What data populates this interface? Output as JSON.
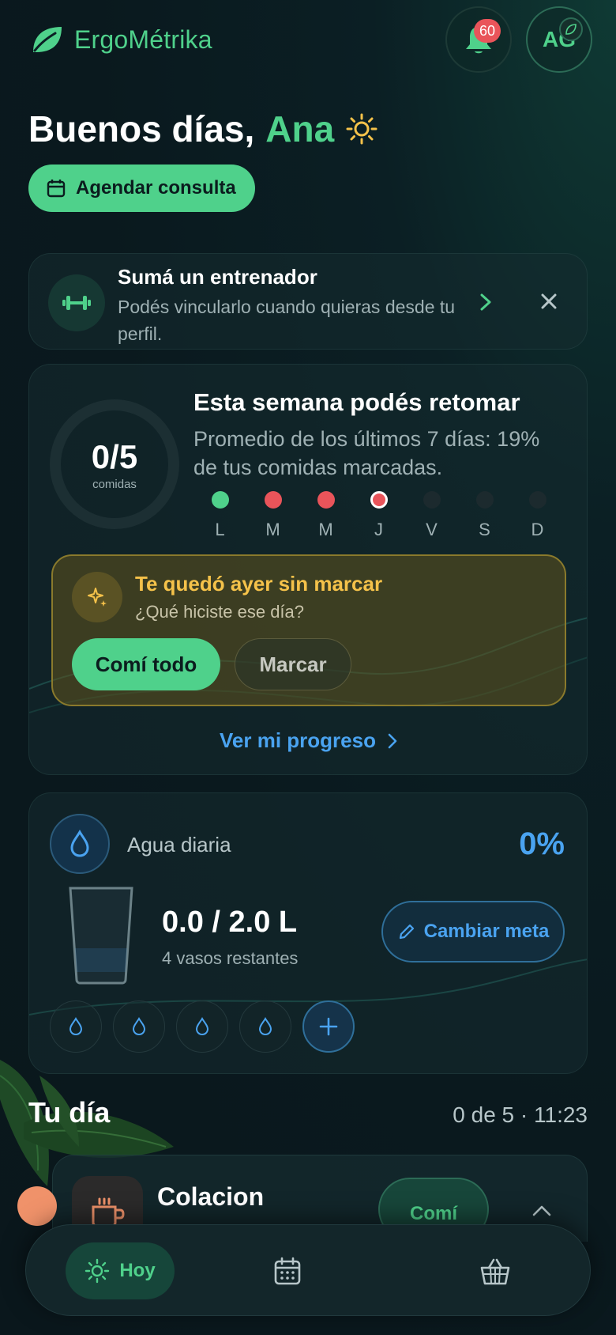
{
  "header": {
    "app_name": "ErgoMétrika",
    "notifications_count": "60",
    "avatar_initials": "AG"
  },
  "greeting": {
    "prefix": "Buenos días,",
    "name": "Ana"
  },
  "schedule_button": "Agendar consulta",
  "trainer_card": {
    "title": "Sumá un entrenador",
    "description": "Podés vincularlo cuando quieras desde tu perfil."
  },
  "week_card": {
    "ring_value": "0/5",
    "ring_label": "comidas",
    "title": "Esta semana podés retomar",
    "subtitle": "Promedio de los últimos 7 días: 19% de tus comidas marcadas.",
    "days": [
      {
        "label": "L",
        "status": "done"
      },
      {
        "label": "M",
        "status": "missed"
      },
      {
        "label": "M",
        "status": "missed"
      },
      {
        "label": "J",
        "status": "today-missed"
      },
      {
        "label": "V",
        "status": "pending"
      },
      {
        "label": "S",
        "status": "pending"
      },
      {
        "label": "D",
        "status": "pending"
      }
    ],
    "missed_title": "Te quedó ayer sin marcar",
    "missed_subtitle": "¿Qué hiciste ese día?",
    "ate_all_button": "Comí todo",
    "mark_button": "Marcar",
    "progress_link": "Ver mi progreso"
  },
  "water_card": {
    "title": "Agua diaria",
    "percent": "0%",
    "amount": "0.0 / 2.0 L",
    "remaining": "4 vasos restantes",
    "change_goal_button": "Cambiar meta",
    "glasses_filled": 0,
    "glasses_total": 4
  },
  "day_section": {
    "title": "Tu día",
    "meta": "0 de 5 · 11:23"
  },
  "meal_card": {
    "title": "Colacion",
    "button": "Comí"
  },
  "nav": {
    "today_label": "Hoy"
  },
  "colors": {
    "accent_green": "#4fd18b",
    "accent_blue": "#4aa3f0",
    "warning_yellow": "#f5c24a",
    "missed_red": "#e9545a",
    "background": "#0a191e"
  }
}
